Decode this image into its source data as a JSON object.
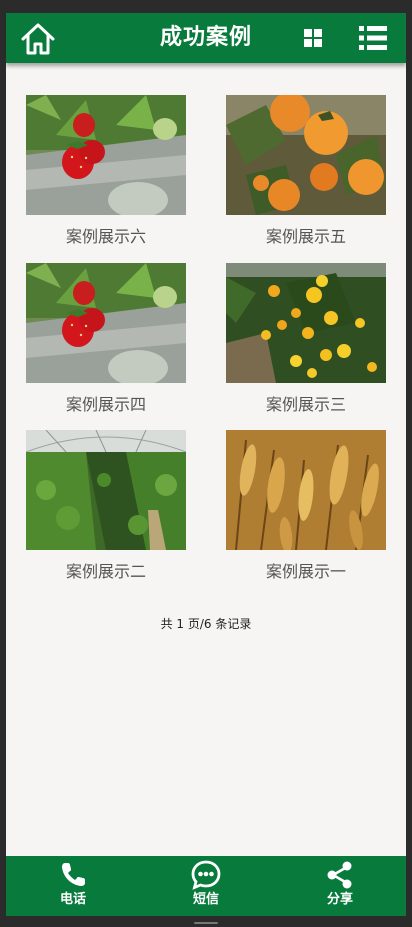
{
  "header": {
    "title": "成功案例"
  },
  "cases": [
    {
      "label": "案例展示六",
      "image": "strawberry-photo"
    },
    {
      "label": "案例展示五",
      "image": "persimmon-photo"
    },
    {
      "label": "案例展示四",
      "image": "strawberry-photo"
    },
    {
      "label": "案例展示三",
      "image": "orange-tree-photo"
    },
    {
      "label": "案例展示二",
      "image": "greenhouse-photo"
    },
    {
      "label": "案例展示一",
      "image": "wheat-photo"
    }
  ],
  "pager": {
    "text": "共 1 页/6 条记录"
  },
  "bottom_bar": {
    "items": [
      {
        "label": "电话",
        "icon": "phone-icon"
      },
      {
        "label": "短信",
        "icon": "sms-icon"
      },
      {
        "label": "分享",
        "icon": "share-icon"
      }
    ]
  },
  "colors": {
    "brand_green": "#087a3c",
    "page_background": "#f6f5f3",
    "outer_background": "#2b2b2b"
  }
}
